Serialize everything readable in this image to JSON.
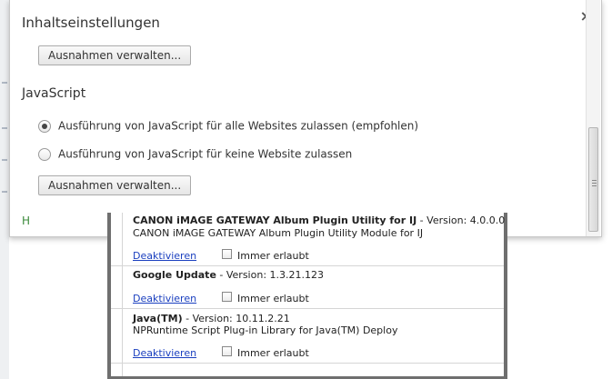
{
  "dialog": {
    "title": "Inhaltseinstellungen",
    "close_glyph": "×",
    "manage_exceptions_label_top": "Ausnahmen verwalten...",
    "javascript": {
      "section_title": "JavaScript",
      "options": [
        {
          "label": "Ausführung von JavaScript für alle Websites zulassen (empfohlen)",
          "checked": true
        },
        {
          "label": "Ausführung von JavaScript für keine Website zulassen",
          "checked": false
        }
      ],
      "manage_exceptions_label": "Ausnahmen verwalten..."
    },
    "partial_next_section": "H"
  },
  "plugins": [
    {
      "name": "CANON iMAGE GATEWAY Album Plugin Utility for IJ",
      "version_text": " - Version: 4.0.0.0",
      "description": "CANON iMAGE GATEWAY Album Plugin Utility Module for IJ",
      "disable_label": "Deaktivieren",
      "always_allowed_label": "Immer erlaubt",
      "always_allowed": false
    },
    {
      "name": "Google Update",
      "version_text": " - Version: 1.3.21.123",
      "description": "",
      "disable_label": "Deaktivieren",
      "always_allowed_label": "Immer erlaubt",
      "always_allowed": false
    },
    {
      "name": "Java(TM)",
      "version_text": " - Version: 10.11.2.21",
      "description": "NPRuntime Script Plug-in Library for Java(TM) Deploy",
      "disable_label": "Deaktivieren",
      "always_allowed_label": "Immer erlaubt",
      "always_allowed": false
    }
  ]
}
